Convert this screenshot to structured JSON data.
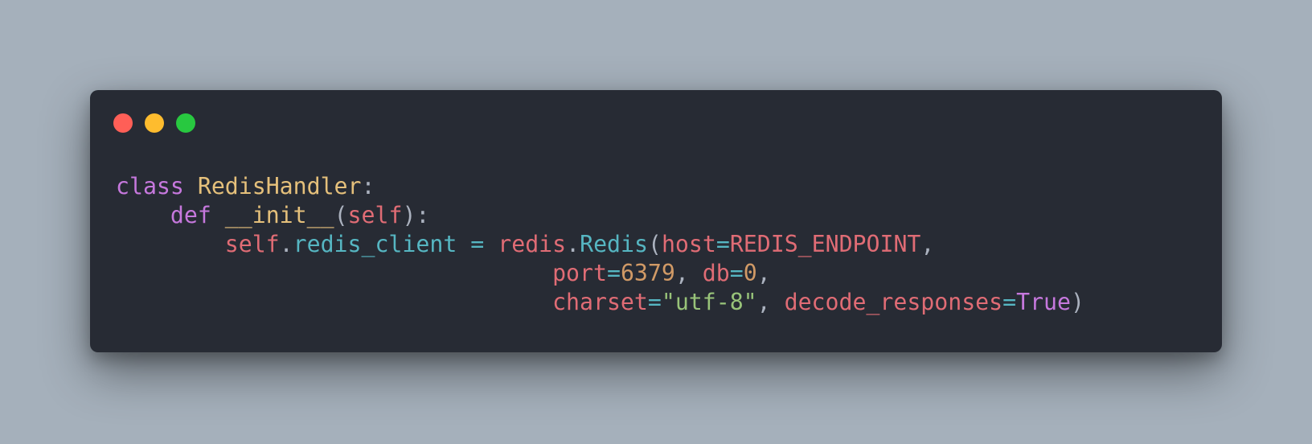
{
  "colors": {
    "background": "#a5b0bb",
    "window": "#272b34",
    "close": "#ff5f57",
    "minimize": "#febc2e",
    "zoom": "#28c840",
    "keyword": "#c678dd",
    "class_name": "#e5c07b",
    "punctuation": "#abb2bf",
    "variable": "#e06c75",
    "property": "#56b6c2",
    "number": "#d19a66",
    "string": "#98c379"
  },
  "window_controls": [
    {
      "name": "close-button",
      "color": "#ff5f57"
    },
    {
      "name": "minimize-button",
      "color": "#febc2e"
    },
    {
      "name": "zoom-button",
      "color": "#28c840"
    }
  ],
  "code_lines": [
    [
      {
        "t": "class",
        "c": "keyword"
      },
      {
        "t": " ",
        "c": "punctuation"
      },
      {
        "t": "RedisHandler",
        "c": "class_name"
      },
      {
        "t": ":",
        "c": "punctuation"
      }
    ],
    [
      {
        "t": "    ",
        "c": "punctuation"
      },
      {
        "t": "def",
        "c": "keyword"
      },
      {
        "t": " ",
        "c": "punctuation"
      },
      {
        "t": "__init__",
        "c": "class_name"
      },
      {
        "t": "(",
        "c": "punctuation"
      },
      {
        "t": "self",
        "c": "variable"
      },
      {
        "t": "):",
        "c": "punctuation"
      }
    ],
    [
      {
        "t": "        ",
        "c": "punctuation"
      },
      {
        "t": "self",
        "c": "variable"
      },
      {
        "t": ".",
        "c": "punctuation"
      },
      {
        "t": "redis_client",
        "c": "property"
      },
      {
        "t": " ",
        "c": "punctuation"
      },
      {
        "t": "=",
        "c": "property"
      },
      {
        "t": " ",
        "c": "punctuation"
      },
      {
        "t": "redis",
        "c": "variable"
      },
      {
        "t": ".",
        "c": "punctuation"
      },
      {
        "t": "Redis",
        "c": "property"
      },
      {
        "t": "(",
        "c": "punctuation"
      },
      {
        "t": "host",
        "c": "variable"
      },
      {
        "t": "=",
        "c": "property"
      },
      {
        "t": "REDIS_ENDPOINT",
        "c": "variable"
      },
      {
        "t": ",",
        "c": "punctuation"
      }
    ],
    [
      {
        "t": "                                ",
        "c": "punctuation"
      },
      {
        "t": "port",
        "c": "variable"
      },
      {
        "t": "=",
        "c": "property"
      },
      {
        "t": "6379",
        "c": "number"
      },
      {
        "t": ", ",
        "c": "punctuation"
      },
      {
        "t": "db",
        "c": "variable"
      },
      {
        "t": "=",
        "c": "property"
      },
      {
        "t": "0",
        "c": "number"
      },
      {
        "t": ",",
        "c": "punctuation"
      }
    ],
    [
      {
        "t": "                                ",
        "c": "punctuation"
      },
      {
        "t": "charset",
        "c": "variable"
      },
      {
        "t": "=",
        "c": "property"
      },
      {
        "t": "\"utf-8\"",
        "c": "string"
      },
      {
        "t": ", ",
        "c": "punctuation"
      },
      {
        "t": "decode_responses",
        "c": "variable"
      },
      {
        "t": "=",
        "c": "property"
      },
      {
        "t": "True",
        "c": "keyword"
      },
      {
        "t": ")",
        "c": "punctuation"
      }
    ]
  ]
}
